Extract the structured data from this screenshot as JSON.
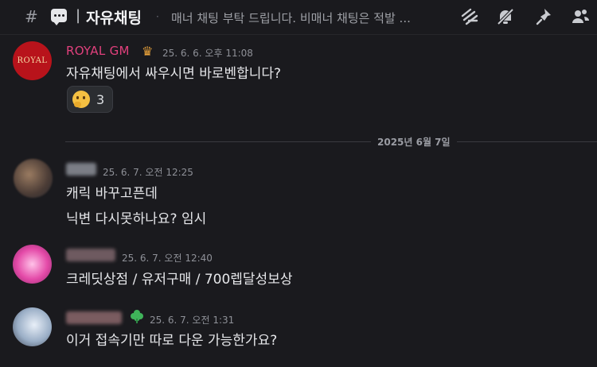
{
  "header": {
    "hash": "#",
    "separator": "|",
    "channel_name": "자유채팅",
    "dot": "·",
    "topic": "매너 채팅 부탁 드립니다. 비매너 채팅은 적발 ..."
  },
  "messages": [
    {
      "author": "ROYAL GM",
      "author_color": "#e0407c",
      "avatar_text": "ROYAL",
      "timestamp": "25. 6. 6. 오후 11:08",
      "lines": [
        "자유채팅에서 싸우시면 바로벤합니다?"
      ],
      "reaction": {
        "emoji": "thinking-face",
        "count": "3"
      }
    },
    {
      "author": "",
      "timestamp": "25. 6. 7. 오전 12:25",
      "lines": [
        "캐릭 바꾸고픈데",
        "닉변 다시못하나요? 임시"
      ]
    },
    {
      "author": "",
      "timestamp": "25. 6. 7. 오전 12:40",
      "lines": [
        "크레딧상점 / 유저구매 / 700렙달성보상"
      ]
    },
    {
      "author": "",
      "timestamp": "25. 6. 7. 오전 1:31",
      "lines": [
        "이거 접속기만 따로 다운 가능한가요?"
      ]
    }
  ],
  "date_divider": "2025년 6월 7일",
  "icons": [
    "threads-icon",
    "mute-bell-icon",
    "pin-icon",
    "members-icon"
  ]
}
